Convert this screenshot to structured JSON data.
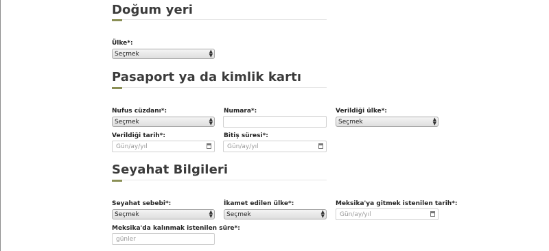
{
  "sections": {
    "birthplace": {
      "title": "Doğum yeri"
    },
    "passport": {
      "title": "Pasaport ya da kimlik kartı"
    },
    "travel": {
      "title": "Seyahat Bilgileri"
    }
  },
  "fields": {
    "country": {
      "label": "Ülke*:",
      "value": "Seçmek"
    },
    "id_doc": {
      "label": "Nufus cüzdanı*:",
      "value": "Seçmek"
    },
    "number": {
      "label": "Numara*:",
      "value": ""
    },
    "issuing_country": {
      "label": "Verildiği ülke*:",
      "value": "Seçmek"
    },
    "issue_date": {
      "label": "Verildiği tarih*:",
      "placeholder": "Gün/ay/yıl"
    },
    "expiry_date": {
      "label": "Bitiş süresi*:",
      "placeholder": "Gün/ay/yıl"
    },
    "travel_reason": {
      "label": "Seyahat sebebi*:",
      "value": "Seçmek"
    },
    "residence_country": {
      "label": "İkamet edilen ülke*:",
      "value": "Seçmek"
    },
    "travel_date": {
      "label": "Meksika'ya gitmek istenilen tarih*:",
      "placeholder": "Gün/ay/yıl"
    },
    "stay_duration": {
      "label": "Meksika'da kalınmak istenilen süre*:",
      "placeholder": "günler"
    }
  },
  "icons": {
    "select_arrow": "updown-arrows-icon",
    "calendar": "calendar-icon"
  }
}
